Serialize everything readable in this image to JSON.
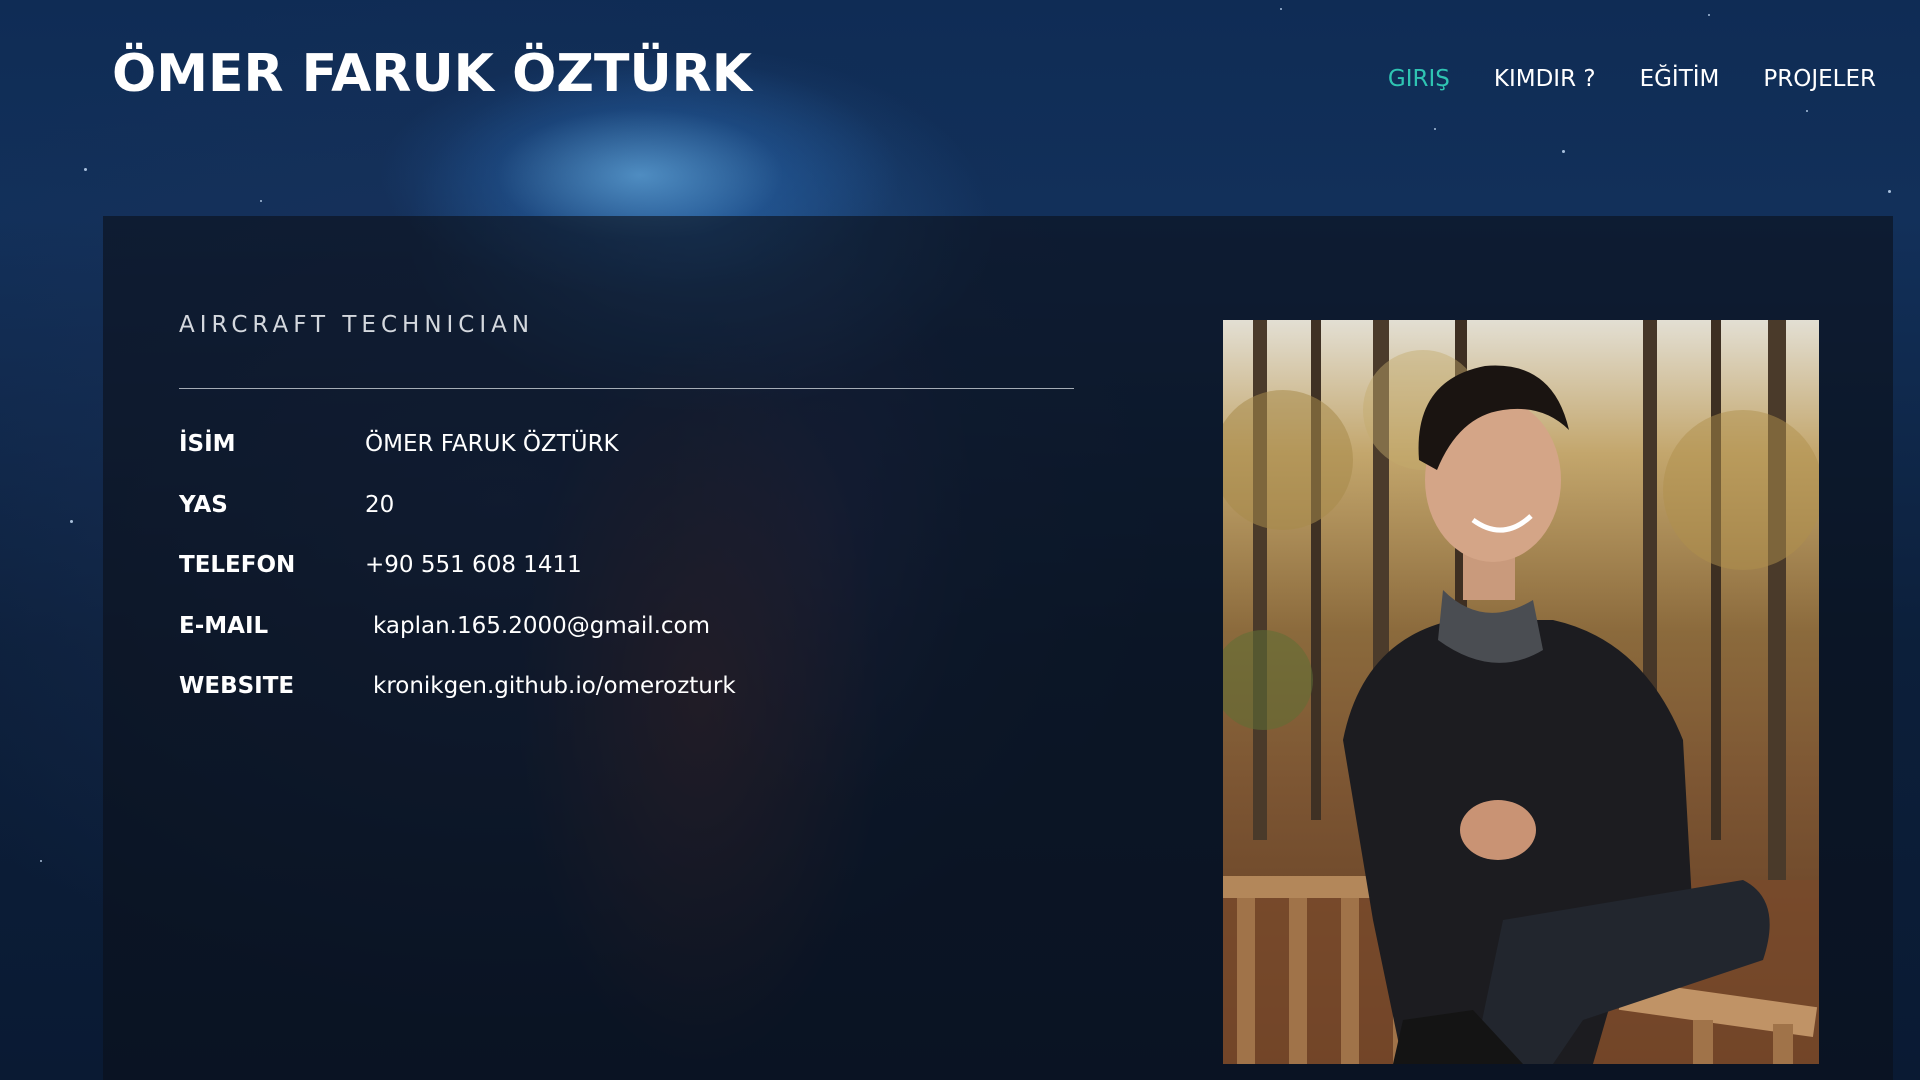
{
  "site": {
    "title": "ÖMER FARUK ÖZTÜRK"
  },
  "nav": {
    "items": [
      {
        "label": "GIRIŞ",
        "active": true
      },
      {
        "label": "KIMDIR ?",
        "active": false
      },
      {
        "label": "EĞİTİM",
        "active": false
      },
      {
        "label": "PROJELER",
        "active": false
      }
    ]
  },
  "profile": {
    "subtitle": "AIRCRAFT TECHNICIAN",
    "rows": [
      {
        "label": "İSİM",
        "value": "ÖMER FARUK ÖZTÜRK"
      },
      {
        "label": "YAS",
        "value": "20"
      },
      {
        "label": "TELEFON",
        "value": "+90 551 608 1411"
      },
      {
        "label": "E-MAIL",
        "value": "kaplan.165.2000@gmail.com"
      },
      {
        "label": "WEBSITE",
        "value": "kronikgen.github.io/omerozturk"
      }
    ]
  },
  "colors": {
    "accent": "#2fc4b2",
    "text": "#ffffff",
    "panel": "#0c101a"
  }
}
